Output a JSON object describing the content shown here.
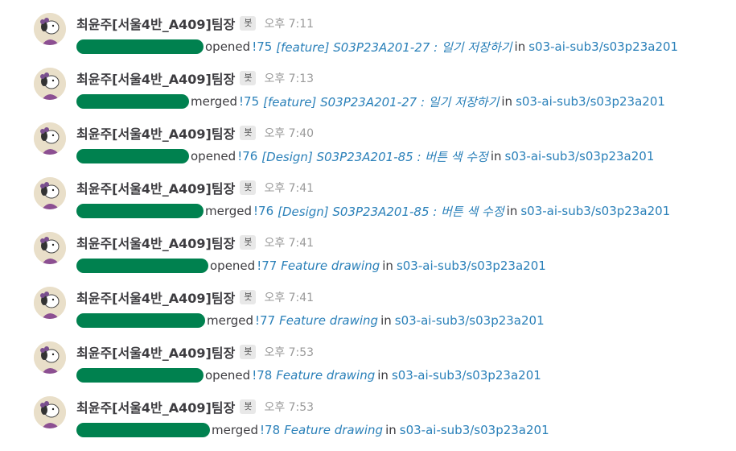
{
  "colors": {
    "link": "#2a80b9",
    "redaction": "#00814f",
    "author": "#3d3c40",
    "time": "#9a9a9a"
  },
  "messages": [
    {
      "author": "최윤주[서울4반_A409]팀장",
      "badge": "봇",
      "time": "오후 7:11",
      "action": "opened",
      "mr": "!75",
      "title": "[feature] S03P23A201-27 : 일기 저장하기",
      "in": "in",
      "repo": "s03-ai-sub3/s03p23a201"
    },
    {
      "author": "최윤주[서울4반_A409]팀장",
      "badge": "봇",
      "time": "오후 7:13",
      "action": "merged",
      "mr": "!75",
      "title": "[feature] S03P23A201-27 : 일기 저장하기",
      "in": "in",
      "repo": "s03-ai-sub3/s03p23a201"
    },
    {
      "author": "최윤주[서울4반_A409]팀장",
      "badge": "봇",
      "time": "오후 7:40",
      "action": "opened",
      "mr": "!76",
      "title": "[Design] S03P23A201-85 : 버튼 색 수정",
      "in": "in",
      "repo": "s03-ai-sub3/s03p23a201"
    },
    {
      "author": "최윤주[서울4반_A409]팀장",
      "badge": "봇",
      "time": "오후 7:41",
      "action": "merged",
      "mr": "!76",
      "title": "[Design] S03P23A201-85 : 버튼 색 수정",
      "in": "in",
      "repo": "s03-ai-sub3/s03p23a201"
    },
    {
      "author": "최윤주[서울4반_A409]팀장",
      "badge": "봇",
      "time": "오후 7:41",
      "action": "opened",
      "mr": "!77",
      "title": "Feature drawing",
      "in": "in",
      "repo": "s03-ai-sub3/s03p23a201"
    },
    {
      "author": "최윤주[서울4반_A409]팀장",
      "badge": "봇",
      "time": "오후 7:41",
      "action": "merged",
      "mr": "!77",
      "title": "Feature drawing",
      "in": "in",
      "repo": "s03-ai-sub3/s03p23a201"
    },
    {
      "author": "최윤주[서울4반_A409]팀장",
      "badge": "봇",
      "time": "오후 7:53",
      "action": "opened",
      "mr": "!78",
      "title": "Feature drawing",
      "in": "in",
      "repo": "s03-ai-sub3/s03p23a201"
    },
    {
      "author": "최윤주[서울4반_A409]팀장",
      "badge": "봇",
      "time": "오후 7:53",
      "action": "merged",
      "mr": "!78",
      "title": "Feature drawing",
      "in": "in",
      "repo": "s03-ai-sub3/s03p23a201"
    }
  ]
}
